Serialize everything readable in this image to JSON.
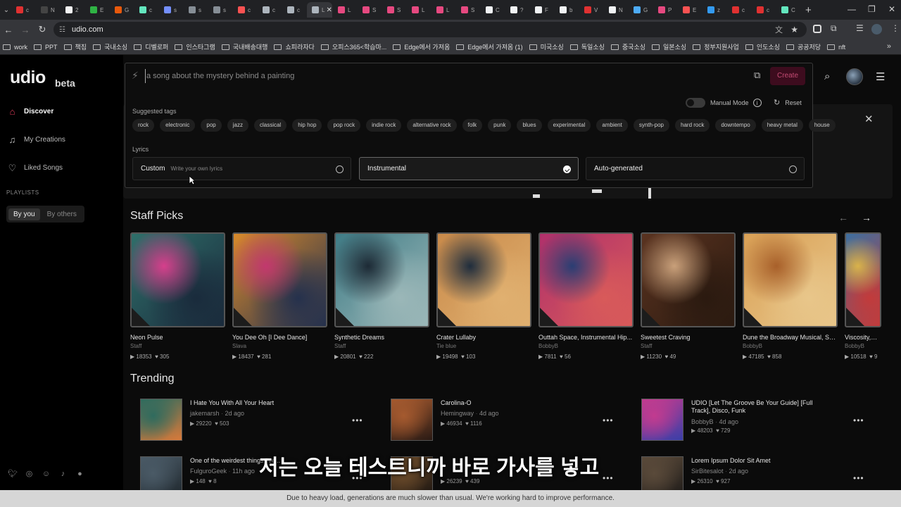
{
  "browser": {
    "tabs": [
      {
        "glyph": "c",
        "color": "#e03131"
      },
      {
        "glyph": "N",
        "color": "#444444"
      },
      {
        "glyph": "2",
        "color": "#f5f5f5"
      },
      {
        "glyph": "E",
        "color": "#2fb344"
      },
      {
        "glyph": "G",
        "color": "#e8590c"
      },
      {
        "glyph": "c",
        "color": "#63e6be"
      },
      {
        "glyph": "s",
        "color": "#748ffc"
      },
      {
        "glyph": "s",
        "color": "#868e96"
      },
      {
        "glyph": "s",
        "color": "#868e96"
      },
      {
        "glyph": "c",
        "color": "#fa5252"
      },
      {
        "glyph": "c",
        "color": "#adb5bd"
      },
      {
        "glyph": "c",
        "color": "#adb5bd"
      },
      {
        "glyph": "L",
        "color": "#adb5bd",
        "active": true
      },
      {
        "glyph": "L",
        "color": "#e64980"
      },
      {
        "glyph": "S",
        "color": "#e64980"
      },
      {
        "glyph": "S",
        "color": "#e64980"
      },
      {
        "glyph": "L",
        "color": "#e64980"
      },
      {
        "glyph": "L",
        "color": "#e64980"
      },
      {
        "glyph": "S",
        "color": "#e64980"
      },
      {
        "glyph": "C",
        "color": "#f1f3f5"
      },
      {
        "glyph": "?",
        "color": "#f1f3f5"
      },
      {
        "glyph": "F",
        "color": "#f1f3f5"
      },
      {
        "glyph": "b",
        "color": "#f1f3f5"
      },
      {
        "glyph": "V",
        "color": "#e03131"
      },
      {
        "glyph": "N",
        "color": "#f1f3f5"
      },
      {
        "glyph": "G",
        "color": "#4dabf7"
      },
      {
        "glyph": "P",
        "color": "#e64980"
      },
      {
        "glyph": "E",
        "color": "#fa5252"
      },
      {
        "glyph": "z",
        "color": "#339af0"
      },
      {
        "glyph": "c",
        "color": "#e03131"
      },
      {
        "glyph": "c",
        "color": "#e03131"
      },
      {
        "glyph": "C",
        "color": "#63e6be"
      }
    ],
    "url": "udio.com",
    "bookmarks": [
      "work",
      "PPT",
      "책집",
      "국내소싱",
      "디벨로퍼",
      "인스타그램",
      "국내배송대행",
      "쇼피라자다",
      "오피스365<학습마...",
      "Edge에서 가져옴",
      "Edge에서 가져옴 (1)",
      "미국소싱",
      "독일소싱",
      "중국소싱",
      "일본소싱",
      "정부지원사업",
      "인도소싱",
      "공공저당",
      "nft"
    ]
  },
  "sidebar": {
    "logo": "udio",
    "logo_suffix": "beta",
    "nav": [
      {
        "label": "Discover",
        "icon": "⌂",
        "active": true
      },
      {
        "label": "My Creations",
        "icon": "♫"
      },
      {
        "label": "Liked Songs",
        "icon": "♡"
      }
    ],
    "playlists_label": "PLAYLISTS",
    "playlist_tabs": [
      "By you",
      "By others"
    ]
  },
  "create": {
    "placeholder": "a song about the mystery behind a painting",
    "create_label": "Create",
    "manual_mode": "Manual Mode",
    "reset": "Reset",
    "tags_label": "Suggested tags",
    "tags": [
      "rock",
      "electronic",
      "pop",
      "jazz",
      "classical",
      "hip hop",
      "pop rock",
      "indie rock",
      "alternative rock",
      "folk",
      "punk",
      "blues",
      "experimental",
      "ambient",
      "synth-pop",
      "hard rock",
      "downtempo",
      "heavy metal",
      "house"
    ],
    "lyrics_label": "Lyrics",
    "lyrics_options": [
      {
        "label": "Custom",
        "hint": "Write your own lyrics"
      },
      {
        "label": "Instrumental",
        "hint": "",
        "selected": true
      },
      {
        "label": "Auto-generated",
        "hint": ""
      }
    ]
  },
  "staff_picks": {
    "title": "Staff Picks",
    "items": [
      {
        "title": "Neon Pulse",
        "artist": "Staff",
        "plays": "18353",
        "likes": "305",
        "colors": [
          "#2f6f6a",
          "#d63f8c",
          "#1a2b3c"
        ]
      },
      {
        "title": "You Dee Oh [I Dee Dance]",
        "artist": "Slava",
        "plays": "18437",
        "likes": "281",
        "colors": [
          "#d98a2b",
          "#c2386e",
          "#25314d"
        ]
      },
      {
        "title": "Synthetic Dreams",
        "artist": "Staff",
        "plays": "20801",
        "likes": "222",
        "colors": [
          "#3f7c86",
          "#1d2a35",
          "#9bb7b8"
        ]
      },
      {
        "title": "Crater Lullaby",
        "artist": "Tie blue",
        "plays": "19498",
        "likes": "103",
        "colors": [
          "#c98a4a",
          "#1f2d3d",
          "#e0b070"
        ]
      },
      {
        "title": "Outtah Space, Instrumental Hip...",
        "artist": "BobbyB",
        "plays": "7811",
        "likes": "56",
        "colors": [
          "#b0306b",
          "#2a3e73",
          "#d85a5a"
        ]
      },
      {
        "title": "Sweetest Craving",
        "artist": "Staff",
        "plays": "11230",
        "likes": "49",
        "colors": [
          "#5a3320",
          "#c9a07a",
          "#2b1a10"
        ]
      },
      {
        "title": "Dune the Broadway Musical, Sh...",
        "artist": "BobbyB",
        "plays": "47185",
        "likes": "858",
        "colors": [
          "#d9a055",
          "#a8602a",
          "#e8c68a"
        ]
      },
      {
        "title": "Viscosity, Ins...",
        "artist": "BobbyB",
        "plays": "10518",
        "likes": "9",
        "colors": [
          "#3d6fa0",
          "#d9b24a",
          "#c23b3b"
        ]
      }
    ]
  },
  "trending": {
    "title": "Trending",
    "items": [
      {
        "title": "I Hate You With All Your Heart",
        "artist": "jakemarsh",
        "age": "2d ago",
        "plays": "29220",
        "likes": "503",
        "colors": [
          "#2f6b5e",
          "#d97a3a"
        ]
      },
      {
        "title": "Carolina-O",
        "artist": "Hemingway",
        "age": "4d ago",
        "plays": "46934",
        "likes": "1116",
        "colors": [
          "#a55a2f",
          "#2a1a14"
        ]
      },
      {
        "title": "UDIO [Let The Groove Be Your Guide] [Full Track], Disco, Funk",
        "artist": "BobbyB",
        "age": "4d ago",
        "plays": "48203",
        "likes": "729",
        "colors": [
          "#c23b8f",
          "#3a3fa8"
        ]
      },
      {
        "title": "One of the weirdest things I've...",
        "artist": "FulguroGeek",
        "age": "11h ago",
        "plays": "148",
        "likes": "8",
        "colors": [
          "#4a5a66",
          "#1e262c"
        ]
      },
      {
        "title": "",
        "artist": "",
        "age": "",
        "plays": "26239",
        "likes": "439",
        "colors": [
          "#6a4a2a",
          "#1a1410"
        ]
      },
      {
        "title": "Lorem Ipsum Dolor Sit Amet",
        "artist": "SirBitesalot",
        "age": "2d ago",
        "plays": "26310",
        "likes": "927",
        "colors": [
          "#5a4a3a",
          "#1d1a18"
        ]
      }
    ]
  },
  "subtitle": "저는 오늘 테스트니까 바로 가사를 넣고",
  "banner": "Due to heavy load, generations are much slower than usual. We're working hard to improve performance."
}
